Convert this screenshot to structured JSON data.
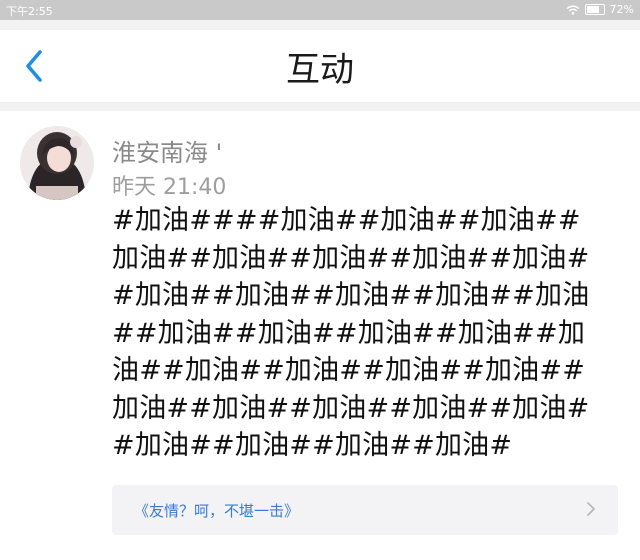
{
  "status_bar": {
    "time": "下午2:55",
    "battery": "72%",
    "battery_level": 0.72
  },
  "header": {
    "title": "互动",
    "back_icon": "chevron-left-icon"
  },
  "post": {
    "author": "淮安南海 '",
    "timestamp": "昨天 21:40",
    "content": "#加油####加油##加油##加油##加油##加油##加油##加油##加油##加油##加油##加油##加油##加油##加油##加油##加油##加油##加油##加油##加油##加油##加油##加油##加油##加油##加油##加油##加油##加油##加油##加油#"
  },
  "linked": {
    "text": "《友情？呵，不堪一击》",
    "icon": "chevron-right-icon"
  },
  "colors": {
    "accent": "#1e8fe1",
    "link": "#3a7bd5",
    "status_bar_bg": "#c9c9c9"
  }
}
